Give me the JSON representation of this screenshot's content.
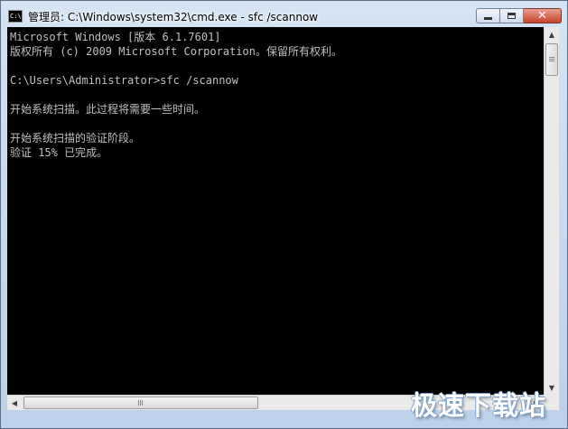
{
  "window": {
    "title": "管理员: C:\\Windows\\system32\\cmd.exe - sfc  /scannow",
    "app_icon_text": "C:\\",
    "buttons": {
      "minimize": "minimize-icon",
      "maximize": "maximize-icon",
      "close": "✕"
    }
  },
  "console": {
    "lines": [
      "Microsoft Windows [版本 6.1.7601]",
      "版权所有 (c) 2009 Microsoft Corporation。保留所有权利。",
      "",
      "C:\\Users\\Administrator>sfc /scannow",
      "",
      "开始系统扫描。此过程将需要一些时间。",
      "",
      "开始系统扫描的验证阶段。",
      "验证 15% 已完成。"
    ],
    "text_color": "#c0c0c0",
    "background": "#000000"
  },
  "scrollbars": {
    "up_arrow": "▲",
    "down_arrow": "▼",
    "left_arrow": "◀",
    "right_arrow": "▶"
  },
  "watermark": "极速下载站"
}
